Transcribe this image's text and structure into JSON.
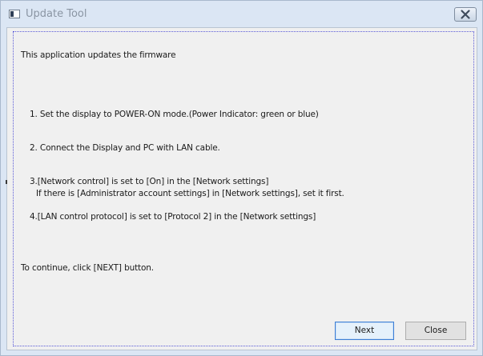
{
  "window": {
    "title": "Update Tool"
  },
  "content": {
    "intro": "This application updates the firmware",
    "steps": [
      "1. Set the display to POWER-ON mode.(Power Indicator: green or blue)",
      "2. Connect the Display and PC with LAN cable.",
      "3.[Network control] is set to [On] in the [Network settings]",
      "If there is [Administrator account settings] in [Network settings], set it first.",
      "4.[LAN control protocol] is set to [Protocol 2] in the [Network settings]"
    ],
    "continue_text": "To continue, click [NEXT] button."
  },
  "buttons": {
    "next_label": "Next",
    "close_label": "Close"
  },
  "icons": {
    "app": "app-window-icon",
    "close": "close-icon"
  },
  "colors": {
    "titlebar": "#dbe6f4",
    "client": "#f0f0f0",
    "focus_border": "#3c7fd6",
    "guide_dotted": "#5a5ad8"
  }
}
